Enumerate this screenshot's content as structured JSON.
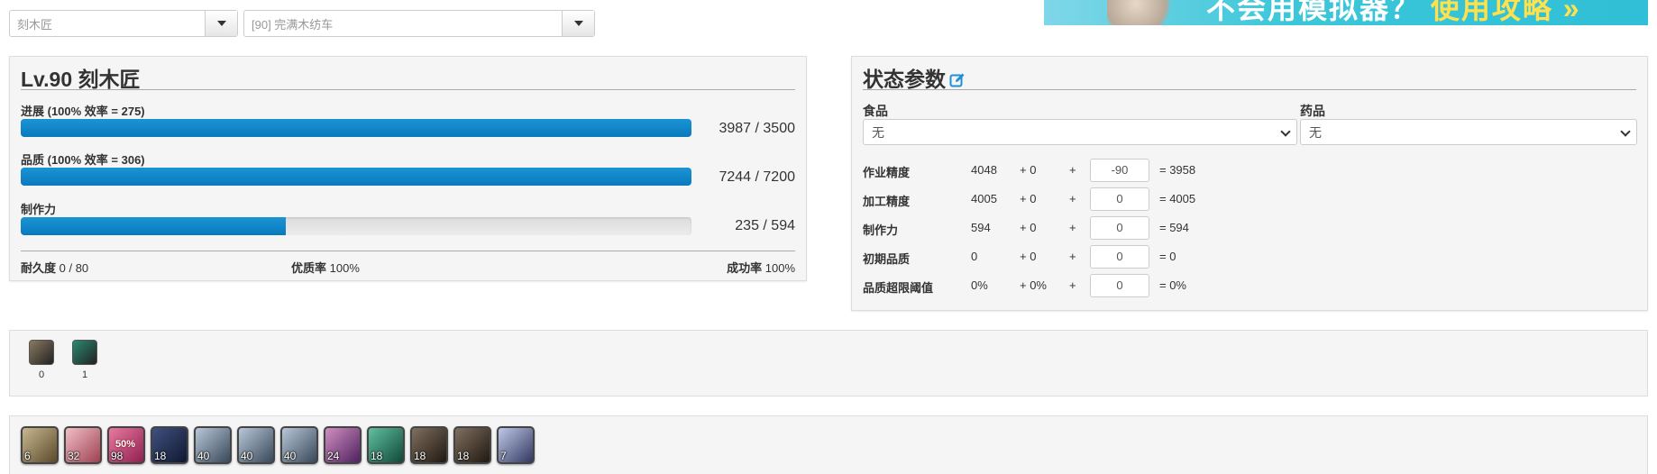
{
  "top": {
    "job_select": "刻木匠",
    "recipe_select": "[90] 完满木纺车"
  },
  "banner": {
    "text_white": "不会用模拟器？",
    "text_highlight": "使用攻略 »"
  },
  "craft": {
    "title": "Lv.90 刻木匠",
    "progress": {
      "label": "进展 (100% 效率 = 275)",
      "value": "3987 / 3500",
      "fill": 1.0
    },
    "quality": {
      "label": "品质  (100% 效率 = 306)",
      "value": "7244 / 7200",
      "fill": 1.0
    },
    "cp": {
      "label": "制作力",
      "value": "235 / 594",
      "fill": 0.3956
    },
    "durability_label": "耐久度",
    "durability_value": "0 / 80",
    "hq_label": "优质率",
    "hq_value": "100%",
    "success_label": "成功率",
    "success_value": "100%"
  },
  "status": {
    "title": "状态参数",
    "food_label": "食品",
    "food_value": "无",
    "potion_label": "药品",
    "potion_value": "无",
    "rows": [
      {
        "label": "作业精度",
        "base": "4048",
        "bonus": "+ 0",
        "plus": "+",
        "input": "-90",
        "total": "= 3958"
      },
      {
        "label": "加工精度",
        "base": "4005",
        "bonus": "+ 0",
        "plus": "+",
        "input": "0",
        "total": "= 4005"
      },
      {
        "label": "制作力",
        "base": "594",
        "bonus": "+ 0",
        "plus": "+",
        "input": "0",
        "total": "= 594"
      },
      {
        "label": "初期品质",
        "base": "0",
        "bonus": "+ 0",
        "plus": "+",
        "input": "0",
        "total": "= 0"
      },
      {
        "label": "品质超限阈值",
        "base": "0%",
        "bonus": "+ 0%",
        "plus": "+",
        "input": "0",
        "total": "= 0%"
      }
    ]
  },
  "buffs": [
    {
      "name": "veneration-buff-icon",
      "count": "0",
      "color": "#8a7a60"
    },
    {
      "name": "innovation-buff-icon",
      "count": "1",
      "color": "#2a8a70"
    }
  ],
  "actions": [
    {
      "name": "muscle-memory-icon",
      "cost": "6",
      "pct": ""
    },
    {
      "name": "manipulation-icon",
      "cost": "32",
      "pct": ""
    },
    {
      "name": "great-strides-icon",
      "cost": "98",
      "pct": "50%"
    },
    {
      "name": "innovation-icon",
      "cost": "18",
      "pct": ""
    },
    {
      "name": "prudent-touch-icon",
      "cost": "40",
      "pct": ""
    },
    {
      "name": "prudent-touch-icon-2",
      "cost": "40",
      "pct": ""
    },
    {
      "name": "prudent-touch-icon-3",
      "cost": "40",
      "pct": ""
    },
    {
      "name": "veneration-icon",
      "cost": "24",
      "pct": ""
    },
    {
      "name": "waste-not-icon",
      "cost": "18",
      "pct": ""
    },
    {
      "name": "groundwork-icon",
      "cost": "18",
      "pct": ""
    },
    {
      "name": "groundwork-icon-2",
      "cost": "18",
      "pct": ""
    },
    {
      "name": "byregots-blessing-icon",
      "cost": "7",
      "pct": ""
    }
  ]
}
